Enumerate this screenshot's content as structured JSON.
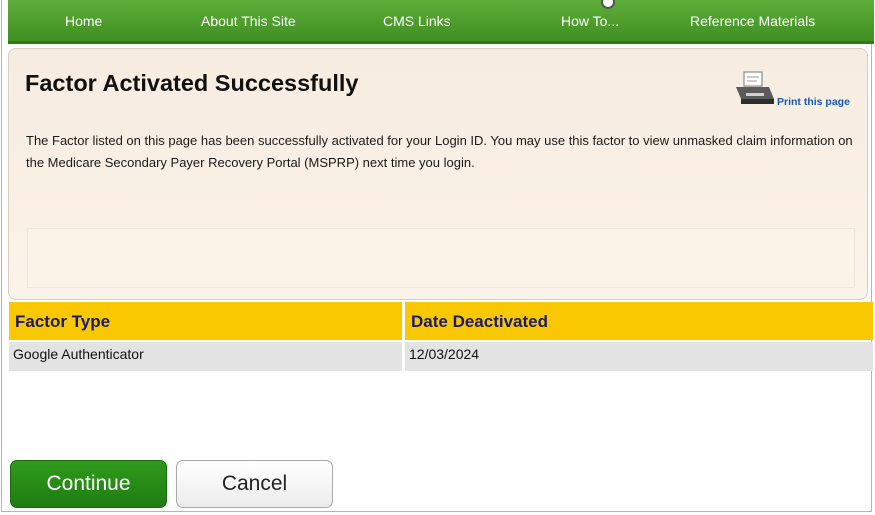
{
  "nav": {
    "items": [
      {
        "label": "Home"
      },
      {
        "label": "About This Site"
      },
      {
        "label": "CMS Links"
      },
      {
        "label": "How To..."
      },
      {
        "label": "Reference Materials"
      }
    ]
  },
  "page": {
    "title": "Factor Activated Successfully",
    "print_label": "Print this page",
    "message": "The Factor listed on this page has been successfully activated for your Login ID. You may use this factor to view unmasked claim information on the Medicare Secondary Payer Recovery Portal (MSPRP) next time you login."
  },
  "table": {
    "headers": [
      "Factor Type",
      "Date Deactivated"
    ],
    "rows": [
      [
        "Google Authenticator",
        "12/03/2024"
      ]
    ]
  },
  "buttons": {
    "continue_label": "Continue",
    "cancel_label": "Cancel"
  },
  "colors": {
    "nav_green": "#3f8f22",
    "header_yellow": "#f9c800",
    "continue_green": "#1f7d10",
    "link_blue": "#1a58b4"
  },
  "icons": {
    "print": "printer-icon"
  }
}
